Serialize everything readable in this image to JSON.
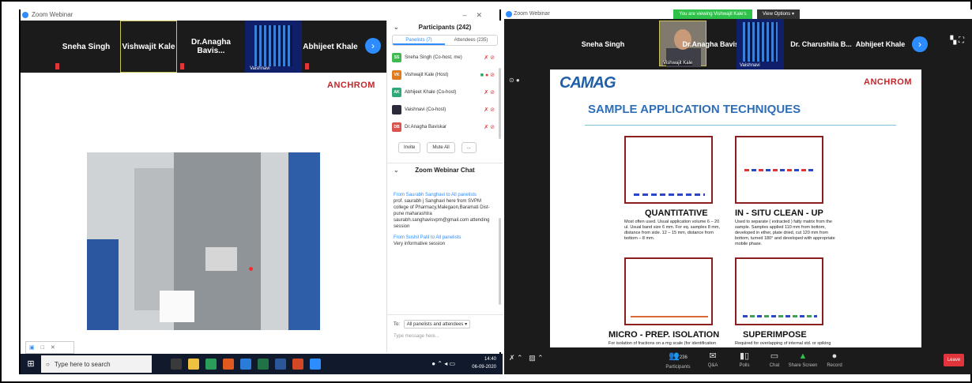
{
  "left": {
    "window_title": "Zoom Webinar",
    "tiles": [
      {
        "name": "Sneha Singh"
      },
      {
        "name": "Vishwajit Kale"
      },
      {
        "name": "Dr.Anagha Bavis..."
      },
      {
        "name": "Vaishnavi",
        "thumb": true
      },
      {
        "name": "Abhijeet Khale"
      }
    ],
    "share_logo": "ANCHROM",
    "participants": {
      "title": "Participants (242)",
      "tab_panelists": "Panelists (7)",
      "tab_attendees": "Attendees (235)",
      "list": [
        {
          "initials": "SS",
          "name": "Sneha Singh (Co-host, me)",
          "color": "#3fb950"
        },
        {
          "initials": "VK",
          "name": "Vishwajit Kale (Host)",
          "color": "#e07b20"
        },
        {
          "initials": "AK",
          "name": "Abhijeet Khale (Co-host)",
          "color": "#2fa87a"
        },
        {
          "initials": "",
          "name": "Vaishnavi (Co-host)",
          "color": "#2a2a3a"
        },
        {
          "initials": "DB",
          "name": "Dr.Anagha Baviskar",
          "color": "#d9534f"
        }
      ],
      "invite": "Invite",
      "mute_all": "Mute All",
      "more": "..."
    },
    "chat": {
      "title": "Zoom Webinar Chat",
      "msg1_from": "From Saurabh Sanghavi to All panelists",
      "msg1_text": "prof. saurabh j Sanghavi here from SVPM college of Pharmacy,Malegaon,Baramati Dist- pune maharashtra saurabh.sanghavisvpm@gmail.com attending session",
      "msg2_from": "From Sushil Patil to All panelists",
      "msg2_text": "Very informative session",
      "to_label": "To:",
      "to_value": "All panelists and attendees ▾",
      "placeholder": "Type message here..."
    },
    "taskbar": {
      "search": "Type here to search",
      "time": "14:40",
      "date": "06-09-2020"
    }
  },
  "right": {
    "window_title": "Zoom Webinar",
    "banner": "You are viewing Vishwajit Kale's screen",
    "view_options": "View Options ▾",
    "tiles": [
      {
        "name": "Sneha Singh"
      },
      {
        "name": "Vishwajit Kale",
        "camera": true
      },
      {
        "name": "Dr.Anagha Bavis..."
      },
      {
        "name": "Vaishnavi",
        "thumb": true
      },
      {
        "name": "Dr. Charushila B..."
      },
      {
        "name": "Abhijeet Khale"
      }
    ],
    "slide": {
      "logo": "CAMAG",
      "logo_right": "ANCHROM",
      "title": "SAMPLE APPLICATION TECHNIQUES",
      "q1_label": "QUANTITATIVE",
      "q1_desc": "Most often used. Usual application volume 6 – 20 ul. Usual band size 6 mm. For eq. samples 8 mm, distance from side. 12 – 15 mm, distance from bottom – 8 mm.",
      "q2_label": "IN - SITU CLEAN - UP",
      "q2_desc": "Used to separate ( extracted ) fatty matrix from the sample. Samples applied 110 mm from bottom, developed in ether, plate dried, cut 120 mm from bottom, turned 180° and developed with appropriate mobile phase.",
      "q3_label": "MICRO - PREP. ISOLATION",
      "q3_desc": "For isolation of fractions on a mg scale (for identification",
      "q4_label": "SUPERIMPOSE",
      "q4_desc": "Required for overlapping of internal std. or spiking"
    },
    "controls": {
      "participants": "Participants",
      "participants_count": "236",
      "qa": "Q&A",
      "polls": "Polls",
      "chat": "Chat",
      "share": "Share Screen",
      "record": "Record",
      "leave": "Leave"
    }
  }
}
